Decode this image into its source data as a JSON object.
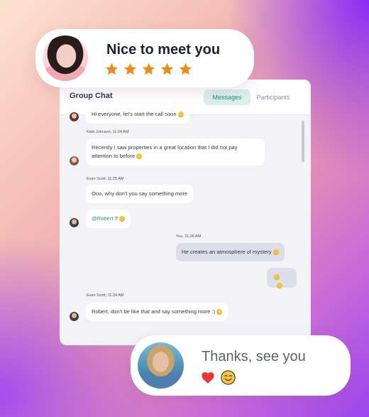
{
  "top_card": {
    "title": "Nice to meet you",
    "rating": 5,
    "star_color": "#f08a1c"
  },
  "bottom_card": {
    "title": "Thanks, see you",
    "icons": [
      "heart-icon",
      "smiley-icon"
    ]
  },
  "chat": {
    "title": "Group Chat",
    "tabs": [
      {
        "label": "Messages",
        "active": true
      },
      {
        "label": "Participants",
        "active": false
      }
    ],
    "messages": [
      {
        "sender": "",
        "text": "Hi everyone, let's start the call soon",
        "emoji": true,
        "direction": "in"
      },
      {
        "sender": "Kate Johnson, 11:24 AM",
        "text": "Recently I saw properties in a great location that I did not pay attention to before",
        "emoji": true,
        "direction": "in"
      },
      {
        "sender": "Evan Scott, 11:25 AM",
        "text": "Ooo, why don't you say something more",
        "emoji": false,
        "direction": "in"
      },
      {
        "sender": "",
        "mention": "@Robert",
        "text": "?",
        "emoji": true,
        "direction": "in"
      },
      {
        "sender": "You, 11:26 AM",
        "text": "He creates an atmosphere of mystery",
        "emoji": true,
        "direction": "out"
      },
      {
        "sender": "",
        "text": "",
        "emoji": true,
        "direction": "out"
      },
      {
        "sender": "Evan Scott, 11:34 AM",
        "text": "Robert, don't be like that and say something more :)",
        "emoji": true,
        "direction": "in"
      }
    ]
  },
  "colors": {
    "accent": "#1f8f82",
    "tab_active_bg": "#d9f0ec",
    "heart": "#e53935",
    "smiley": "#f5c542"
  }
}
